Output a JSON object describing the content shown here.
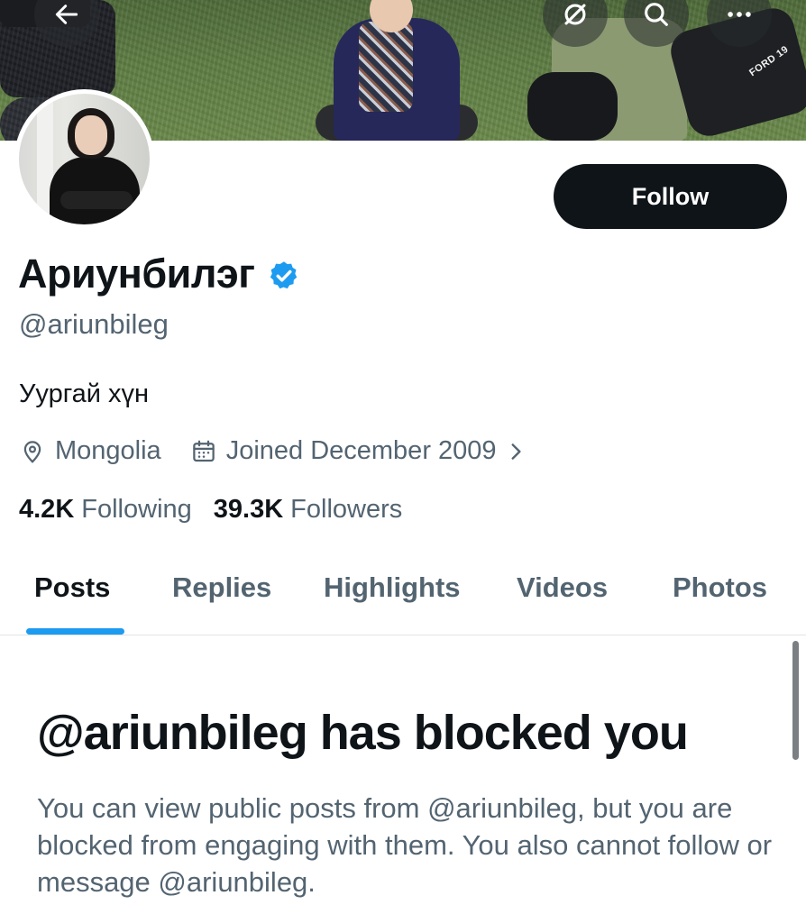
{
  "banner": {
    "text": "FORD 19"
  },
  "nav": {
    "back_icon": "arrow-left-icon",
    "hide_icon": "eye-slash-icon",
    "search_icon": "search-icon",
    "more_icon": "more-horizontal-icon"
  },
  "profile": {
    "display_name": "Ариунбилэг",
    "verified": true,
    "handle": "@ariunbileg",
    "bio": "Уургай хүн",
    "location": "Mongolia",
    "joined": "Joined December 2009",
    "following_count": "4.2K",
    "following_label": "Following",
    "followers_count": "39.3K",
    "followers_label": "Followers"
  },
  "actions": {
    "follow_label": "Follow"
  },
  "tabs": [
    {
      "label": "Posts",
      "active": true
    },
    {
      "label": "Replies",
      "active": false
    },
    {
      "label": "Highlights",
      "active": false
    },
    {
      "label": "Videos",
      "active": false
    },
    {
      "label": "Photos",
      "active": false
    }
  ],
  "blocked": {
    "title": "@ariunbileg has blocked you",
    "message": "You can view public posts from @ariunbileg, but you are blocked from engaging with them. You also cannot follow or message @ariunbileg."
  },
  "colors": {
    "accent": "#1d9bf0",
    "text_primary": "#0f1419",
    "text_secondary": "#536471",
    "button_bg": "#0f1419"
  }
}
